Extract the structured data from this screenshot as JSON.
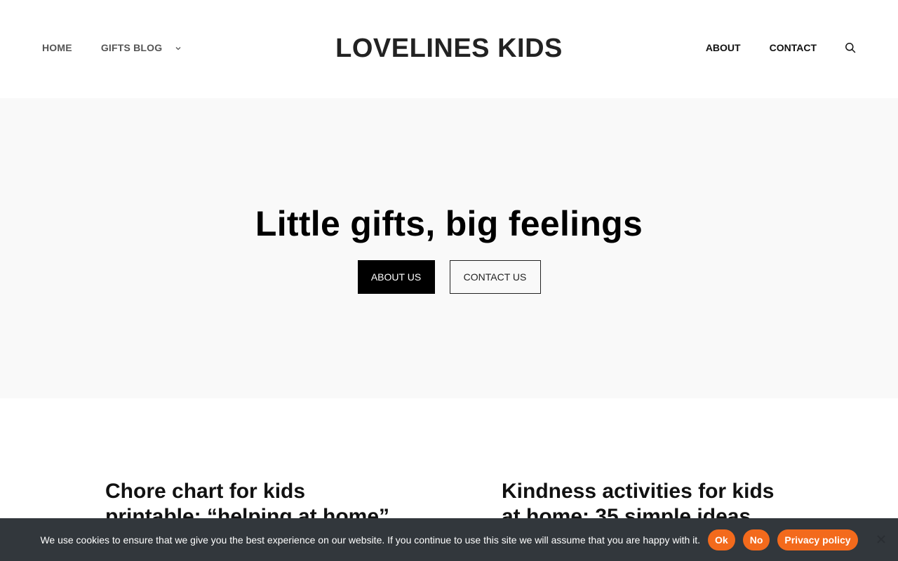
{
  "header": {
    "logo": "LOVELINES KIDS",
    "nav_left": [
      {
        "label": "HOME"
      },
      {
        "label": "GIFTS BLOG",
        "icon": "chevron-down-icon"
      }
    ],
    "nav_right": [
      {
        "label": "ABOUT"
      },
      {
        "label": "CONTACT"
      }
    ],
    "search_icon": "search-icon"
  },
  "hero": {
    "title": "Little gifts, big feelings",
    "buttons": {
      "primary": "ABOUT US",
      "secondary": "CONTACT US"
    }
  },
  "posts": [
    {
      "title": "Chore chart for kids printable: “helping at home”"
    },
    {
      "title": "Kindness activities for kids at home: 35 simple ideas"
    }
  ],
  "cookie_bar": {
    "text": "We use cookies to ensure that we give you the best experience on our website. If you continue to use this site we will assume that you are happy with it.",
    "ok": "Ok",
    "no": "No",
    "privacy": "Privacy policy",
    "close_icon": "close-icon"
  },
  "colors": {
    "accent": "#f36a1c",
    "cookie_bg": "#32373c",
    "hero_bg": "#f9f9f9"
  }
}
